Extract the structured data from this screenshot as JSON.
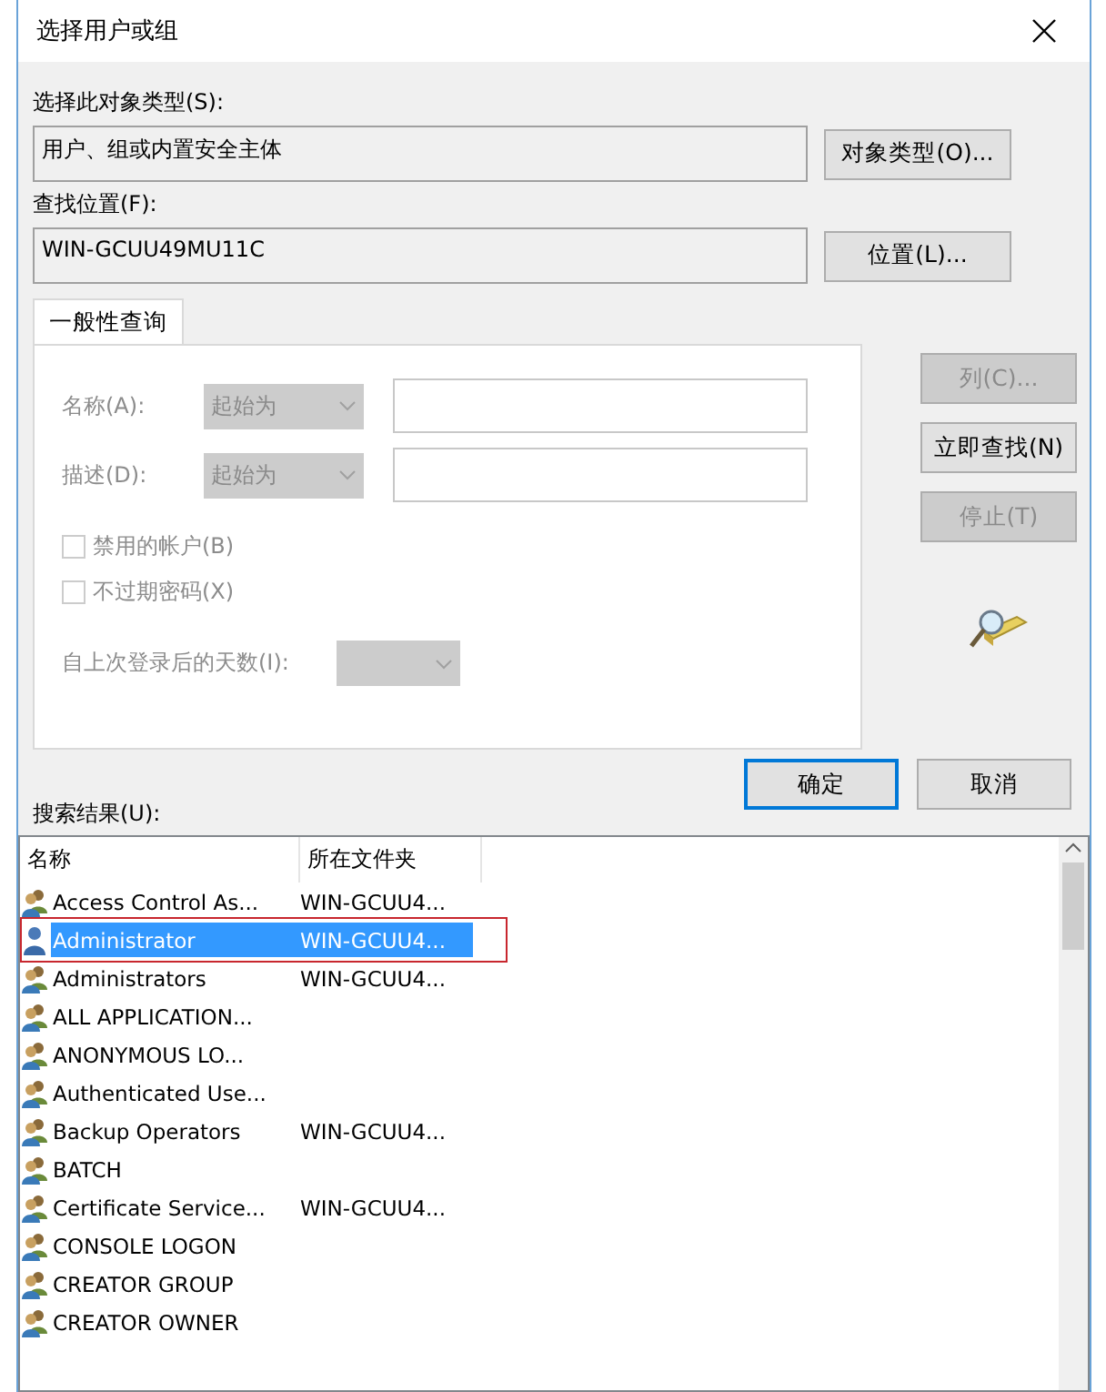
{
  "window": {
    "title": "选择用户或组"
  },
  "object_type": {
    "label": "选择此对象类型(S):",
    "value": "用户、组或内置安全主体",
    "button": "对象类型(O)..."
  },
  "location": {
    "label": "查找位置(F):",
    "value": "WIN-GCUU49MU11C",
    "button": "位置(L)..."
  },
  "tabs": [
    {
      "label": "一般性查询",
      "selected": true
    }
  ],
  "query": {
    "rows": [
      {
        "label": "名称(A):",
        "mode": "起始为",
        "disabled": true
      },
      {
        "label": "描述(D):",
        "mode": "起始为",
        "disabled": true
      }
    ],
    "checkboxes": [
      {
        "label": "禁用的帐户(B)",
        "checked": false,
        "disabled": true
      },
      {
        "label": "不过期密码(X)",
        "checked": false,
        "disabled": true
      }
    ],
    "days_label": "自上次登录后的天数(I):",
    "days_disabled": true
  },
  "side_buttons": [
    {
      "label": "列(C)...",
      "disabled": true
    },
    {
      "label": "立即查找(N)",
      "disabled": false
    },
    {
      "label": "停止(T)",
      "disabled": true
    }
  ],
  "dialog_buttons": [
    {
      "label": "确定",
      "default": true
    },
    {
      "label": "取消",
      "default": false
    }
  ],
  "results": {
    "label": "搜索结果(U):",
    "columns": [
      "名称",
      "所在文件夹"
    ],
    "rows": [
      {
        "kind": "group",
        "name": "Access Control As...",
        "folder": "WIN-GCUU4...",
        "selected": false,
        "annotated": false
      },
      {
        "kind": "user",
        "name": "Administrator",
        "folder": "WIN-GCUU4...",
        "selected": true,
        "annotated": true
      },
      {
        "kind": "group",
        "name": "Administrators",
        "folder": "WIN-GCUU4...",
        "selected": false,
        "annotated": false
      },
      {
        "kind": "group",
        "name": "ALL APPLICATION...",
        "selected": false,
        "annotated": false
      },
      {
        "kind": "group",
        "name": "ANONYMOUS LO...",
        "selected": false,
        "annotated": false
      },
      {
        "kind": "group",
        "name": "Authenticated Use...",
        "selected": false,
        "annotated": false
      },
      {
        "kind": "group",
        "name": "Backup Operators",
        "folder": "WIN-GCUU4...",
        "selected": false,
        "annotated": false
      },
      {
        "kind": "group",
        "name": "BATCH",
        "selected": false,
        "annotated": false
      },
      {
        "kind": "group",
        "name": "Certificate Service...",
        "folder": "WIN-GCUU4...",
        "selected": false,
        "annotated": false
      },
      {
        "kind": "group",
        "name": "CONSOLE LOGON",
        "selected": false,
        "annotated": false
      },
      {
        "kind": "group",
        "name": "CREATOR GROUP",
        "selected": false,
        "annotated": false
      },
      {
        "kind": "group",
        "name": "CREATOR OWNER",
        "selected": false,
        "annotated": false
      }
    ]
  }
}
